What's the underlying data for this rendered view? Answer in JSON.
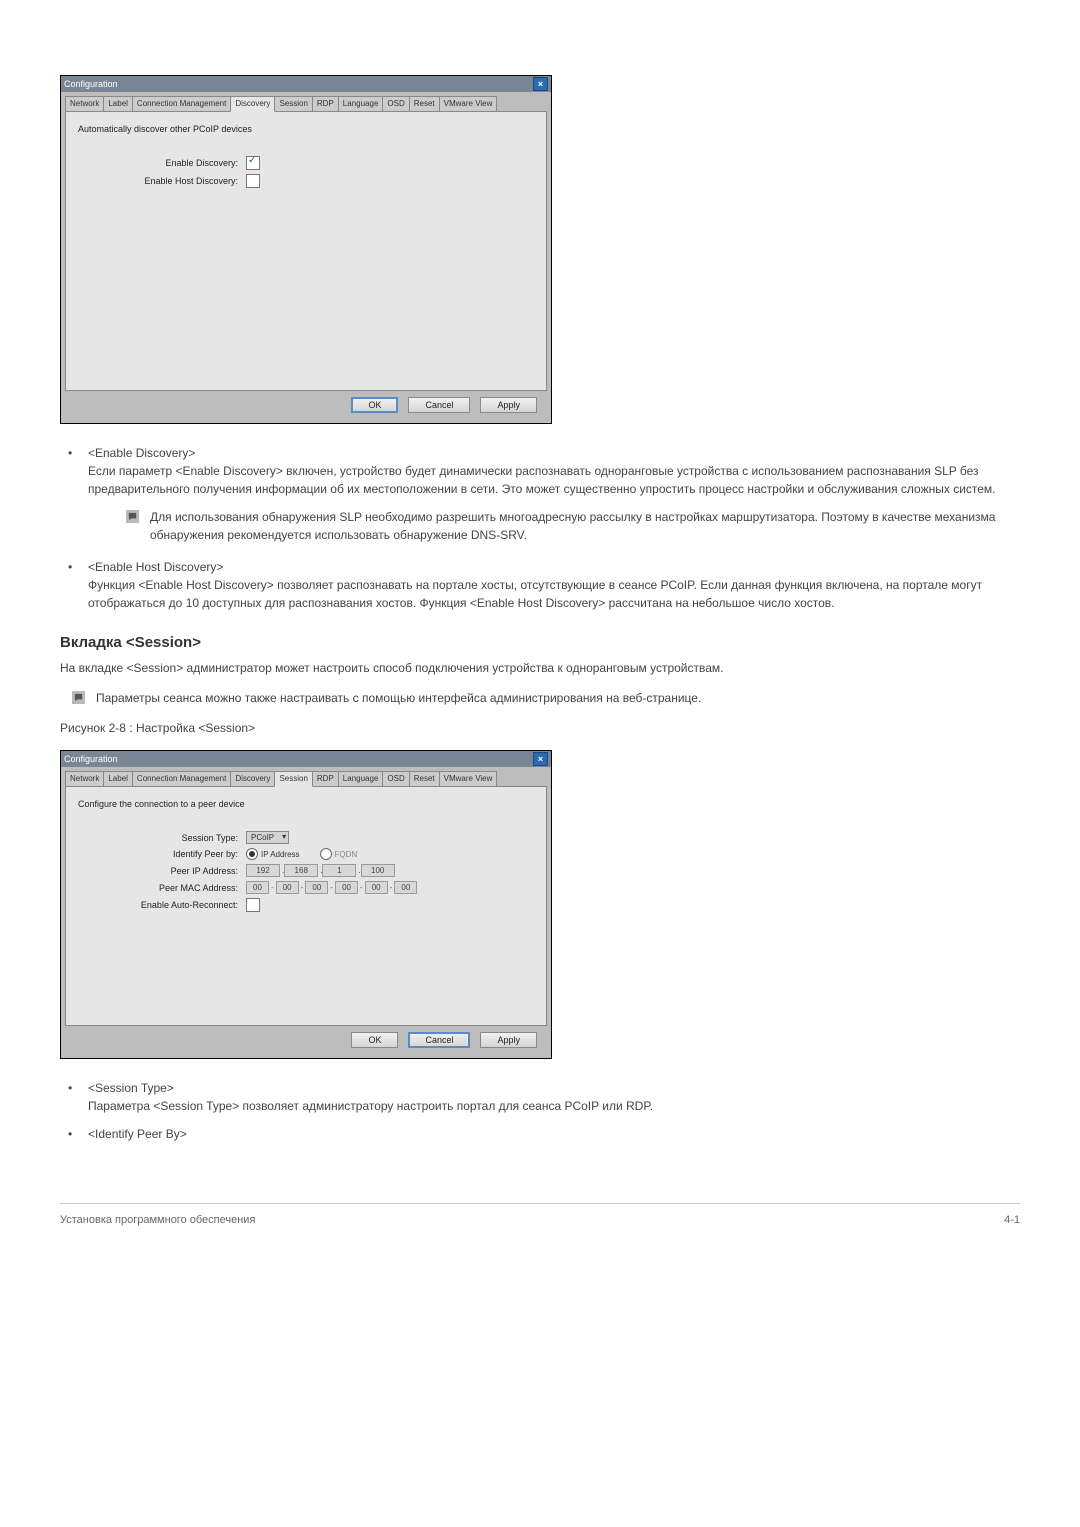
{
  "dialog1": {
    "title": "Configuration",
    "close": "×",
    "tabs": [
      "Network",
      "Label",
      "Connection Management",
      "Discovery",
      "Session",
      "RDP",
      "Language",
      "OSD",
      "Reset",
      "VMware View"
    ],
    "active_tab": 3,
    "desc": "Automatically discover other PCoIP devices",
    "rows": {
      "enable_discovery_label": "Enable Discovery:",
      "enable_host_discovery_label": "Enable Host Discovery:"
    },
    "buttons": {
      "ok": "OK",
      "cancel": "Cancel",
      "apply": "Apply"
    }
  },
  "content": {
    "item1_term": "<Enable Discovery>",
    "item1_desc": "Если параметр <Enable Discovery> включен, устройство будет динамически распознавать одноранговые устройства с использованием распознавания SLP без предварительного получения информации об их местоположении в сети. Это может существенно упростить процесс настройки и обслуживания сложных систем.",
    "note1": "Для использования обнаружения SLP необходимо разрешить многоадресную рассылку в настройках маршрутизатора. Поэтому в качестве механизма обнаружения рекомендуется использовать обнаружение DNS-SRV.",
    "item2_term": "<Enable Host Discovery>",
    "item2_desc": "Функция <Enable Host Discovery> позволяет распознавать на портале хосты, отсутствующие в сеансе PCoIP. Если данная функция включена, на портале могут отображаться до 10 доступных для распознавания хостов. Функция <Enable Host Discovery> рассчитана на небольшое число хостов.",
    "section_title": "Вкладка <Session>",
    "section_intro": "На вкладке <Session> администратор может настроить способ подключения устройства к одноранговым устройствам.",
    "note2": "Параметры сеанса можно также настраивать с помощью интерфейса администрирования на веб-странице.",
    "figure_caption": "Рисунок  2-8 : Настройка <Session>",
    "item3_term": "<Session Type>",
    "item3_desc": "Параметра <Session Type> позволяет администратору настроить портал для сеанса PCoIP или RDP.",
    "item4_term": "<Identify Peer By>"
  },
  "dialog2": {
    "title": "Configuration",
    "close": "×",
    "tabs": [
      "Network",
      "Label",
      "Connection Management",
      "Discovery",
      "Session",
      "RDP",
      "Language",
      "OSD",
      "Reset",
      "VMware View"
    ],
    "active_tab": 4,
    "desc": "Configure the connection to a peer device",
    "rows": {
      "session_type_label": "Session Type:",
      "session_type_value": "PCoIP",
      "identify_peer_label": "Identify Peer by:",
      "identify_opt_ip": "IP Address",
      "identify_opt_fqdn": "FQDN",
      "peer_ip_label": "Peer IP Address:",
      "peer_ip_parts": [
        "192",
        "168",
        "1",
        "100"
      ],
      "peer_mac_label": "Peer MAC Address:",
      "peer_mac_parts": [
        "00",
        "00",
        "00",
        "00",
        "00",
        "00"
      ],
      "auto_reconnect_label": "Enable Auto-Reconnect:"
    },
    "buttons": {
      "ok": "OK",
      "cancel": "Cancel",
      "apply": "Apply"
    }
  },
  "footer": {
    "left": "Установка программного обеспечения",
    "right": "4-1"
  }
}
